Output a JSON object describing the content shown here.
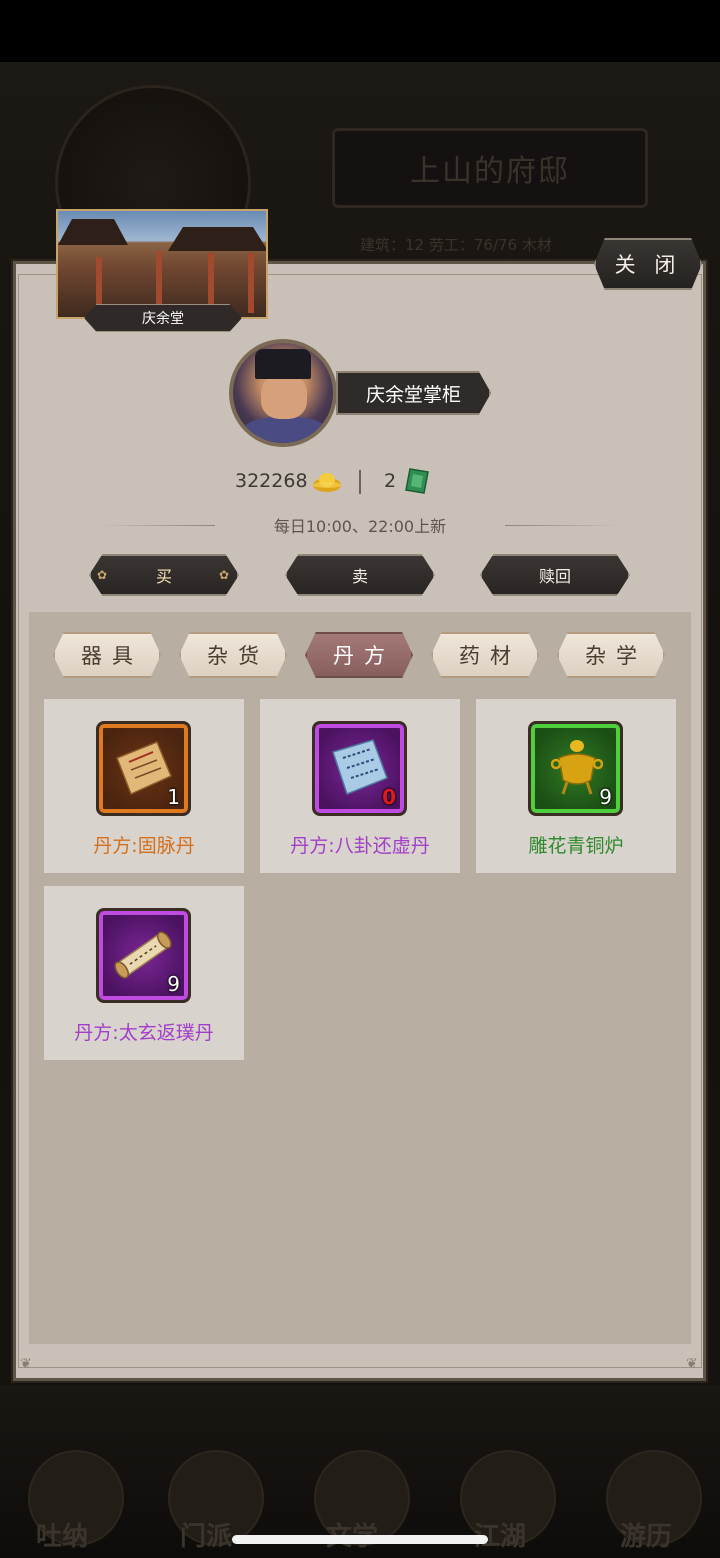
{
  "background": {
    "residence_title": "上山的府邸",
    "stats_text": "建筑：12   劳工：76/76   木材",
    "nav_labels": [
      "吐纳",
      "门派",
      "文学",
      "江湖",
      "游历"
    ]
  },
  "shop": {
    "name": "庆余堂",
    "close_label": "关 闭",
    "merchant_name": "庆余堂掌柜",
    "gold_amount": "322268",
    "jade_amount": "2",
    "refresh_text": "每日10:00、22:00上新",
    "trade_buttons": [
      "买",
      "卖",
      "赎回"
    ],
    "tabs": [
      "器具",
      "杂货",
      "丹方",
      "药材",
      "杂学"
    ],
    "active_tab": "丹方"
  },
  "items": [
    {
      "name": "丹方:固脉丹",
      "count": "1",
      "rarity": "orange",
      "icon": "recipe-paper-icon"
    },
    {
      "name": "丹方:八卦还虚丹",
      "count": "0",
      "rarity": "purple",
      "icon": "blue-recipe-paper-icon"
    },
    {
      "name": "雕花青铜炉",
      "count": "9",
      "rarity": "green",
      "icon": "bronze-censer-icon"
    },
    {
      "name": "丹方:太玄返璞丹",
      "count": "9",
      "rarity": "purple",
      "icon": "scroll-icon"
    }
  ],
  "colors": {
    "orange_text": "#d4701d",
    "purple_text": "#a33ec9",
    "green_text": "#2f8a2c",
    "active_tab": "#875f5d"
  }
}
